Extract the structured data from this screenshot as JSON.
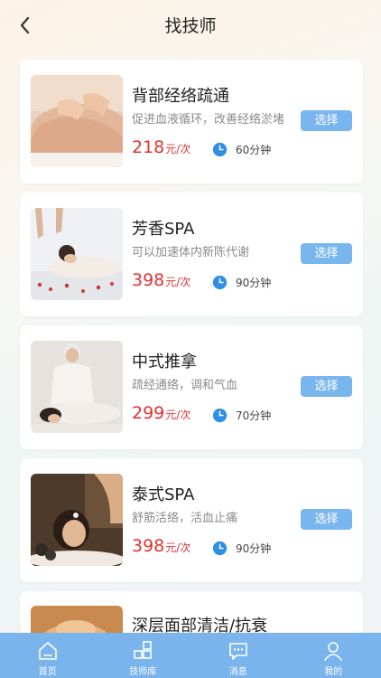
{
  "header": {
    "title": "找技师",
    "back_icon": "chevron-left-icon"
  },
  "services": [
    {
      "name": "背部经络疏通",
      "desc": "促进血液循环，改善经络淤堵",
      "price": "218",
      "price_unit": "元/次",
      "duration": "60分钟",
      "select_label": "选择",
      "image": "back-massage-photo"
    },
    {
      "name": "芳香SPA",
      "desc": "可以加速体内新陈代谢",
      "price": "398",
      "price_unit": "元/次",
      "duration": "90分钟",
      "select_label": "选择",
      "image": "aroma-spa-photo"
    },
    {
      "name": "中式推拿",
      "desc": "疏经通络，调和气血",
      "price": "299",
      "price_unit": "元/次",
      "duration": "70分钟",
      "select_label": "选择",
      "image": "chinese-massage-photo"
    },
    {
      "name": "泰式SPA",
      "desc": "舒筋活络，活血止痛",
      "price": "398",
      "price_unit": "元/次",
      "duration": "90分钟",
      "select_label": "选择",
      "image": "thai-spa-photo"
    },
    {
      "name": "深层面部清洁/抗衰",
      "desc": "",
      "price": "",
      "price_unit": "",
      "duration": "",
      "select_label": "",
      "image": "facial-photo"
    }
  ],
  "colors": {
    "accent": "#7ab6ee",
    "price": "#e23232",
    "tabbar": "#7ab4ec",
    "clock": "#2f8fe6"
  },
  "tabbar": {
    "items": [
      {
        "label": "首页",
        "icon": "home-icon"
      },
      {
        "label": "技师库",
        "icon": "grid-icon"
      },
      {
        "label": "消息",
        "icon": "message-icon"
      },
      {
        "label": "我的",
        "icon": "user-icon"
      }
    ]
  }
}
